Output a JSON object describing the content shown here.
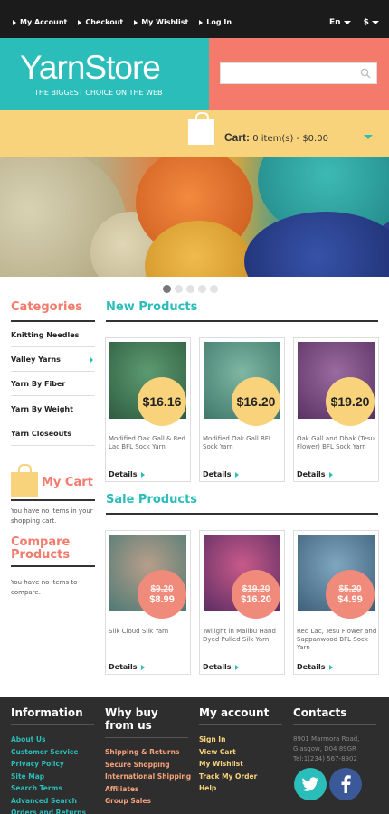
{
  "topnav": {
    "links": [
      "My Account",
      "Checkout",
      "My Wishlist",
      "Log In"
    ],
    "language": "En",
    "currency": "$"
  },
  "header": {
    "logo": "YarnStore",
    "tagline": "THE BIGGEST CHOICE ON THE WEB",
    "search_placeholder": ""
  },
  "cart": {
    "label": "Cart:",
    "summary": "0 item(s) - $0.00"
  },
  "slider": {
    "slides": 5,
    "active": 1
  },
  "sidebar": {
    "categories_title": "Categories",
    "categories": [
      "Knitting Needles",
      "Valley Yarns",
      "Yarn By Fiber",
      "Yarn By Weight",
      "Yarn Closeouts"
    ],
    "mycart_title": "My Cart",
    "mycart_text": "You have no items in your shopping cart.",
    "compare_title": "Compare Products",
    "compare_text": "You have no items to compare."
  },
  "new_products": {
    "title": "New Products",
    "items": [
      {
        "name": "Modified Oak Gall & Red Lac BFL Sock Yarn",
        "price": "$16.16",
        "details": "Details"
      },
      {
        "name": "Modified Oak Gall BFL Sock Yarn",
        "price": "$16.20",
        "details": "Details"
      },
      {
        "name": "Oak Gall and Dhak (Tesu Flower) BFL Sock Yarn",
        "price": "$19.20",
        "details": "Details"
      }
    ]
  },
  "sale_products": {
    "title": "Sale Products",
    "items": [
      {
        "name": "Silk Cloud Silk Yarn",
        "old_price": "$9.20",
        "price": "$8.99",
        "details": "Details"
      },
      {
        "name": "Twilight in Malibu Hand Dyed Pulled Silk Yarn",
        "old_price": "$19.20",
        "price": "$16.20",
        "details": "Details"
      },
      {
        "name": "Red Lac, Tesu Flower and Sappanwood BFL Sock Yarn",
        "old_price": "$5.20",
        "price": "$4.99",
        "details": "Details"
      }
    ]
  },
  "footer": {
    "information": {
      "title": "Information",
      "links": [
        "About Us",
        "Customer Service",
        "Privacy Policy",
        "Site Map",
        "Search Terms",
        "Advanced Search",
        "Orders and Returns"
      ]
    },
    "why_buy": {
      "title": "Why buy from us",
      "links": [
        "Shipping & Returns",
        "Secure Shopping",
        "International Shipping",
        "Affiliates",
        "Group Sales"
      ]
    },
    "account": {
      "title": "My account",
      "links": [
        "Sign In",
        "View Cart",
        "My Wishlist",
        "Track My Order",
        "Help"
      ]
    },
    "contacts": {
      "title": "Contacts",
      "address_line1": "8901 Marmora Road,",
      "address_line2": "Glasgow, D04 89GR",
      "phone": "Tel:1(234) 567-8902"
    }
  },
  "colors": {
    "teal": "#2bbdb9",
    "coral": "#f47a6c",
    "yellow": "#f8d37b",
    "dark": "#1b1b1b"
  }
}
